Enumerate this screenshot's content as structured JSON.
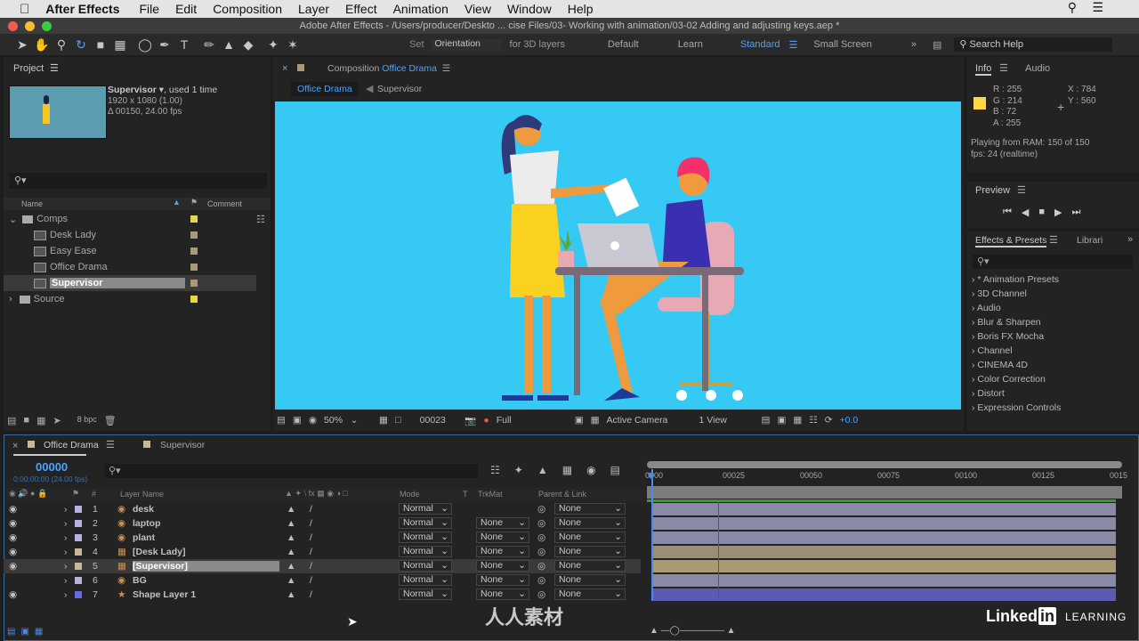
{
  "menubar": {
    "app": "After Effects",
    "items": [
      "File",
      "Edit",
      "Composition",
      "Layer",
      "Effect",
      "Animation",
      "View",
      "Window",
      "Help"
    ]
  },
  "titlebar": {
    "title": "Adobe After Effects - /Users/producer/Deskto ... cise Files/03- Working with animation/03-02 Adding and adjusting keys.aep *"
  },
  "toolbar": {
    "set_label": "Set",
    "orientation": "Orientation",
    "for3d": "for 3D layers",
    "workspaces": [
      "Default",
      "Learn",
      "Standard",
      "Small Screen"
    ],
    "active_workspace": "Standard",
    "search_help": "Search Help"
  },
  "project": {
    "title": "Project",
    "selected_name": "Supervisor",
    "used": ", used 1 time",
    "resolution": "1920 x 1080 (1.00)",
    "duration": "Δ 00150, 24.00 fps",
    "col_name": "Name",
    "col_comment": "Comment",
    "bpc": "8 bpc",
    "items": [
      {
        "name": "Comps",
        "type": "folder",
        "open": true,
        "color": "#e6d64a"
      },
      {
        "name": "Desk Lady",
        "type": "comp",
        "color": "#a89878"
      },
      {
        "name": "Easy Ease",
        "type": "comp",
        "color": "#a89878"
      },
      {
        "name": "Office Drama",
        "type": "comp",
        "color": "#a89878"
      },
      {
        "name": "Supervisor",
        "type": "comp",
        "color": "#a89878",
        "selected": true
      },
      {
        "name": "Source",
        "type": "folder",
        "open": false,
        "color": "#e6d64a"
      }
    ]
  },
  "composition": {
    "panel_label": "Composition",
    "name": "Office Drama",
    "tabs": [
      "Office Drama",
      "Supervisor"
    ],
    "bg_color": "#35c9f4",
    "zoom": "50%",
    "frame": "00023",
    "resolution": "Full",
    "camera": "Active Camera",
    "views": "1 View",
    "exposure": "+0.0"
  },
  "info": {
    "tabs": [
      "Info",
      "Audio"
    ],
    "R": "255",
    "G": "214",
    "B": "72",
    "A": "255",
    "X": "784",
    "Y": "560",
    "swatch": "#ffd648",
    "status1": "Playing from RAM: 150 of 150",
    "status2": "fps: 24 (realtime)"
  },
  "preview": {
    "title": "Preview"
  },
  "effects": {
    "tabs": [
      "Effects & Presets",
      "Librari"
    ],
    "items": [
      "* Animation Presets",
      "3D Channel",
      "Audio",
      "Blur & Sharpen",
      "Boris FX Mocha",
      "Channel",
      "CINEMA 4D",
      "Color Correction",
      "Distort",
      "Expression Controls"
    ]
  },
  "timeline": {
    "tabs": [
      "Office Drama",
      "Supervisor"
    ],
    "timecode": "00000",
    "timecode_sub": "0:00:00:00 (24.00 fps)",
    "cols": {
      "num": "#",
      "name": "Layer Name",
      "mode": "Mode",
      "t": "T",
      "trkmat": "TrkMat",
      "parent": "Parent & Link"
    },
    "ruler": [
      "0000",
      "00025",
      "00050",
      "00075",
      "00100",
      "00125",
      "0015"
    ],
    "layers": [
      {
        "num": "1",
        "name": "desk",
        "label": "#b5b0e0",
        "mode": "Normal",
        "trkmat": "",
        "parent": "None",
        "bar": "#8a89a6",
        "icon": "ai",
        "visible": true
      },
      {
        "num": "2",
        "name": "laptop",
        "label": "#b5b0e0",
        "mode": "Normal",
        "trkmat": "None",
        "parent": "None",
        "bar": "#8a89a6",
        "icon": "ai",
        "visible": true
      },
      {
        "num": "3",
        "name": "plant",
        "label": "#b5b0e0",
        "mode": "Normal",
        "trkmat": "None",
        "parent": "None",
        "bar": "#8a89a6",
        "icon": "ai",
        "visible": true
      },
      {
        "num": "4",
        "name": "[Desk Lady]",
        "label": "#c8b898",
        "mode": "Normal",
        "trkmat": "None",
        "parent": "None",
        "bar": "#9a8e74",
        "icon": "comp",
        "visible": true
      },
      {
        "num": "5",
        "name": "[Supervisor]",
        "label": "#c8b898",
        "mode": "Normal",
        "trkmat": "None",
        "parent": "None",
        "bar": "#a89a76",
        "icon": "comp",
        "visible": true,
        "selected": true
      },
      {
        "num": "6",
        "name": "BG",
        "label": "#b5b0e0",
        "mode": "Normal",
        "trkmat": "None",
        "parent": "None",
        "bar": "#8a89a6",
        "icon": "ai",
        "visible": false
      },
      {
        "num": "7",
        "name": "Shape Layer 1",
        "label": "#6a6ae0",
        "mode": "Normal",
        "trkmat": "None",
        "parent": "None",
        "bar": "#5b5bb0",
        "icon": "star",
        "visible": true
      }
    ]
  },
  "watermark": {
    "brand": "Linked",
    "brand_in": "in",
    "learning": "LEARNING",
    "site": "人人素材"
  }
}
